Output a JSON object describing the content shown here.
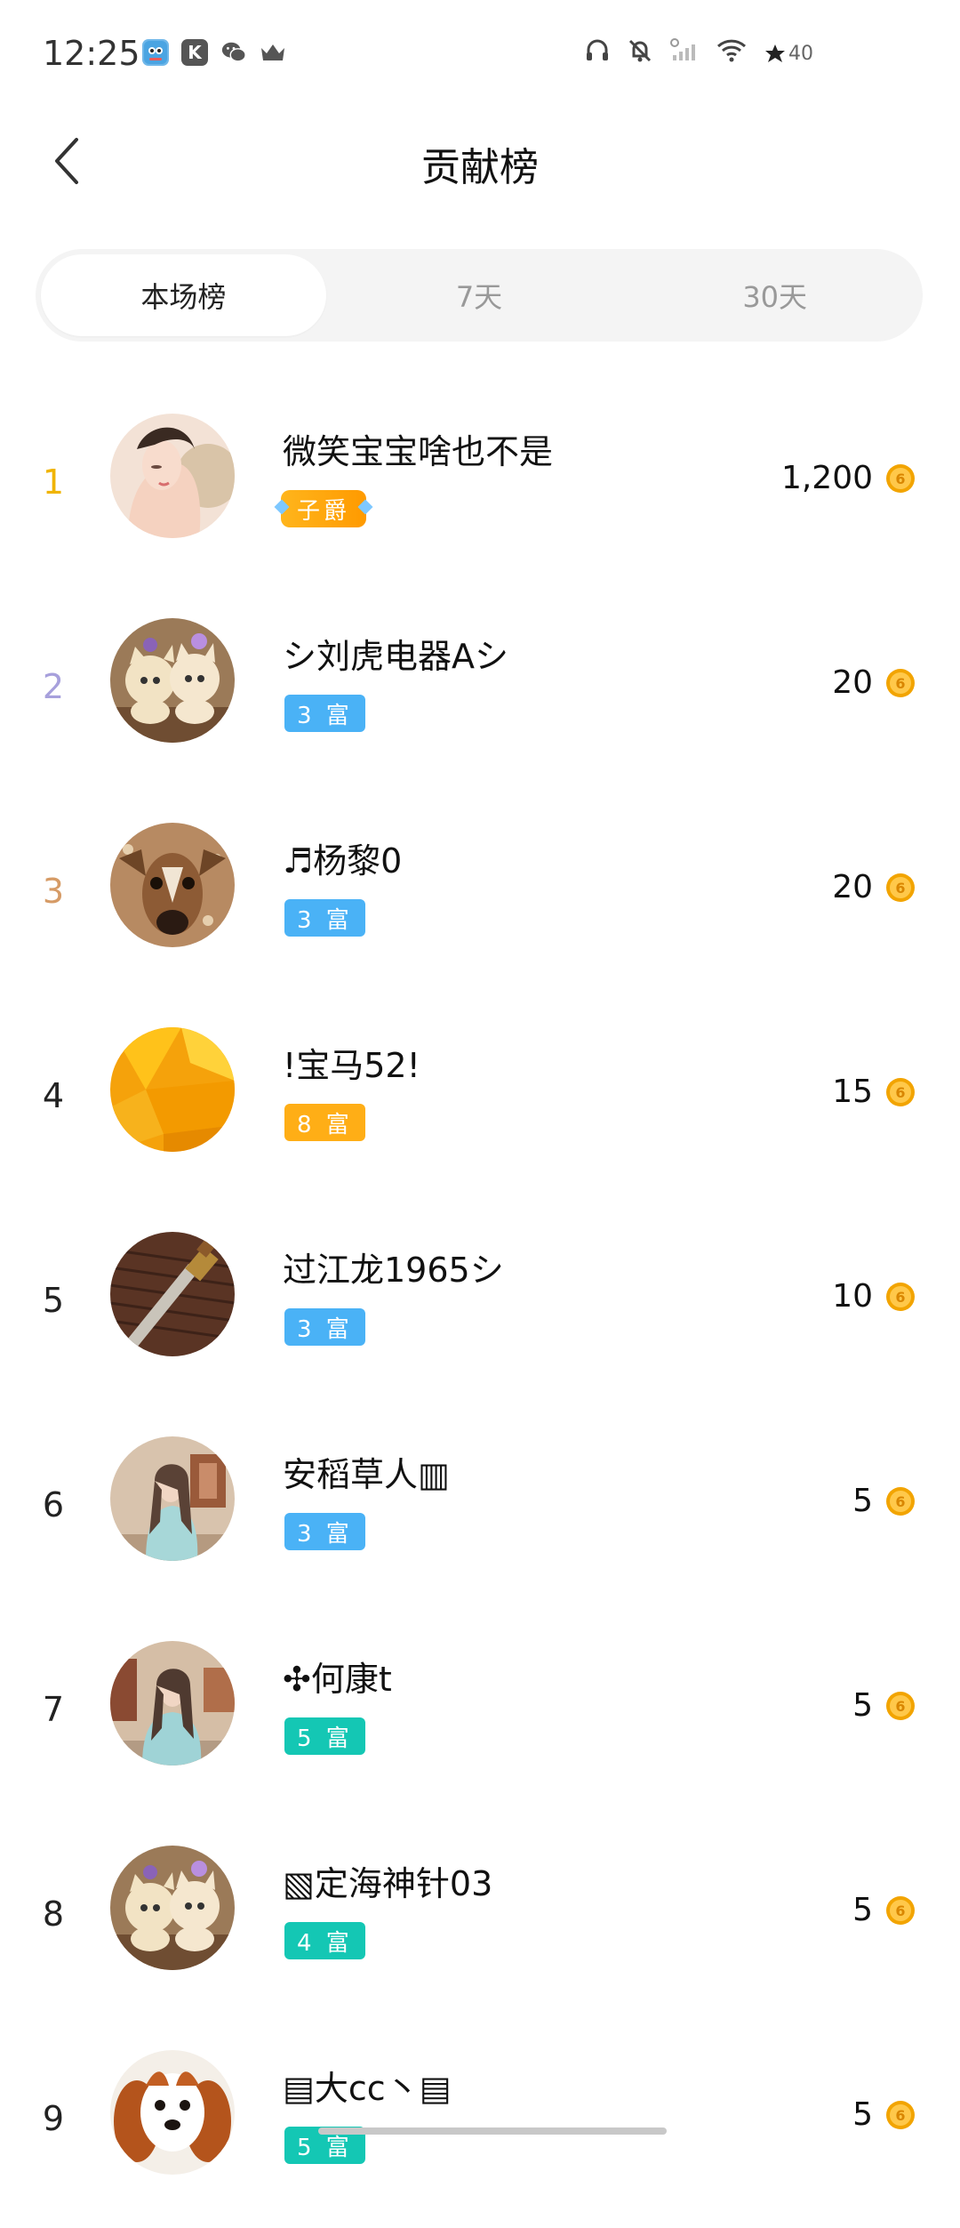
{
  "status_bar": {
    "time": "12:25",
    "battery": "40",
    "icons": [
      "game-app-icon",
      "k-app-icon",
      "wechat-icon",
      "crown-icon",
      "headphone-icon",
      "bell-off-icon",
      "signal-icon",
      "wifi-icon",
      "battery-icon"
    ]
  },
  "header": {
    "title": "贡献榜"
  },
  "tabs": [
    {
      "label": "本场榜",
      "active": true
    },
    {
      "label": "7天",
      "active": false
    },
    {
      "label": "30天",
      "active": false
    }
  ],
  "colors": {
    "rank1": "#f0b400",
    "rank2": "#a7a0dc",
    "rank3": "#d69b66",
    "rank_default": "#222222",
    "badge_blue": "#4ab2f6",
    "badge_orange": "#ffae16",
    "badge_teal": "#14c7b4",
    "badge_gold": "#ffa40b",
    "coin": "#f2a400"
  },
  "entries": [
    {
      "rank": "1",
      "name": "微笑宝宝啥也不是",
      "badge": "子爵",
      "badge_type": "gold",
      "score": "1,200",
      "avatar": "portrait-girl"
    },
    {
      "rank": "2",
      "name": "シ刘虎电器Aシ",
      "badge": "3 富",
      "badge_type": "blue",
      "score": "20",
      "avatar": "plush-cats"
    },
    {
      "rank": "3",
      "name": "♬杨黎0",
      "badge": "3 富",
      "badge_type": "blue",
      "score": "20",
      "avatar": "deer"
    },
    {
      "rank": "4",
      "name": "!宝马52!",
      "badge": "8 富",
      "badge_type": "orange",
      "score": "15",
      "avatar": "yellow-abstract"
    },
    {
      "rank": "5",
      "name": "过江龙1965シ",
      "badge": "3 富",
      "badge_type": "blue",
      "score": "10",
      "avatar": "knife"
    },
    {
      "rank": "6",
      "name": "安稻草人▥",
      "badge": "3 富",
      "badge_type": "blue",
      "score": "5",
      "avatar": "woman-room"
    },
    {
      "rank": "7",
      "name": "✣何康t",
      "badge": "5 富",
      "badge_type": "teal",
      "score": "5",
      "avatar": "woman-room2"
    },
    {
      "rank": "8",
      "name": "▧定海神针03",
      "badge": "4 富",
      "badge_type": "teal",
      "score": "5",
      "avatar": "plush-cats"
    },
    {
      "rank": "9",
      "name": "▤大cc丶▤",
      "badge": "5 富",
      "badge_type": "teal",
      "score": "5",
      "avatar": "dog"
    }
  ]
}
